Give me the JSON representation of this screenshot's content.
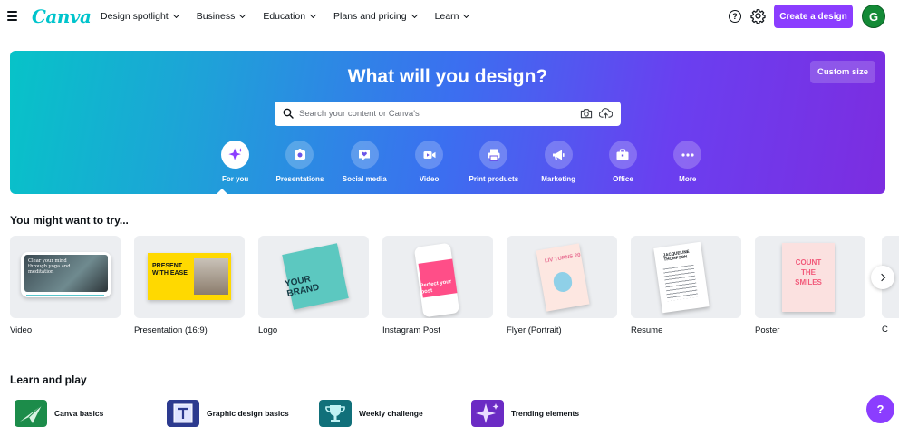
{
  "nav": {
    "logo": "Canva",
    "items": [
      "Design spotlight",
      "Business",
      "Education",
      "Plans and pricing",
      "Learn"
    ],
    "help_label": "?",
    "create_label": "Create a design",
    "avatar_initial": "G"
  },
  "hero": {
    "title": "What will you design?",
    "custom_size": "Custom size",
    "search_placeholder": "Search your content or Canva's",
    "categories": [
      "For you",
      "Presentations",
      "Social media",
      "Video",
      "Print products",
      "Marketing",
      "Office",
      "More"
    ],
    "active_category": "For you"
  },
  "try": {
    "title": "You might want to try...",
    "cards": [
      "Video",
      "Presentation (16:9)",
      "Logo",
      "Instagram Post",
      "Flyer (Portrait)",
      "Resume",
      "Poster"
    ],
    "partial_label": "C",
    "thumb_text": {
      "video": "Clear your mind through yoga and meditation",
      "presentation": "PRESENT WITH EASE",
      "logo": "YOUR BRAND",
      "instagram": "Perfect your post",
      "flyer": "LIV TURNS 20",
      "resume": "JACQUELINE THOMPSON",
      "poster": "COUNT THE SMILES"
    }
  },
  "learn": {
    "title": "Learn and play",
    "items": [
      "Canva basics",
      "Graphic design basics",
      "Weekly challenge",
      "Trending elements"
    ]
  },
  "fab_label": "?",
  "colors": {
    "brand": "#8b3dff",
    "logo": "#00c4cc",
    "avatar": "#138a36"
  }
}
